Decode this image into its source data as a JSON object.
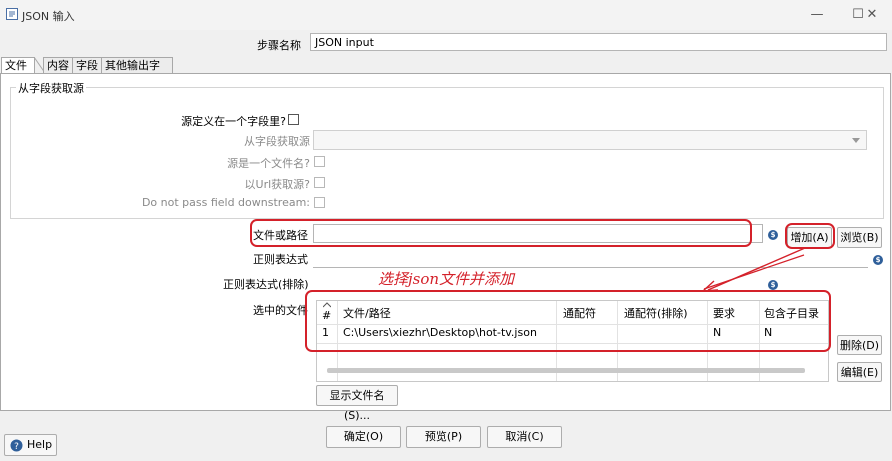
{
  "window": {
    "title": "JSON 输入",
    "minimize": "—",
    "maximize": "☐",
    "close": "✕"
  },
  "step_name": {
    "label": "步骤名称",
    "value": "JSON input"
  },
  "tabs": [
    {
      "label": "文件"
    },
    {
      "label": "内容"
    },
    {
      "label": "字段"
    },
    {
      "label": "其他输出字段"
    }
  ],
  "source_group": {
    "title": "从字段获取源",
    "source_in_field": "源定义在一个字段里?",
    "get_source_from_field": "从字段获取源",
    "source_is_filename": "源是一个文件名?",
    "read_source_as_url": "以Url获取源?",
    "do_not_pass_field": "Do not pass field downstream:"
  },
  "file_or_dir": {
    "label": "文件或路径",
    "value": ""
  },
  "regex": {
    "label": "正则表达式",
    "value": ""
  },
  "regex_exclude": {
    "label": "正则表达式(排除)",
    "value": ""
  },
  "selected_files": {
    "label": "选中的文件"
  },
  "buttons": {
    "add": "增加(A)",
    "browse": "浏览(B)",
    "delete": "删除(D)",
    "edit": "编辑(E)",
    "show_filenames": "显示文件名(S)...",
    "ok": "确定(O)",
    "preview": "预览(P)",
    "cancel": "取消(C)",
    "help": "Help"
  },
  "table": {
    "columns": [
      "#",
      "文件/路径",
      "通配符",
      "通配符(排除)",
      "要求",
      "包含子目录"
    ],
    "rows": [
      [
        "1",
        "C:\\Users\\xiezhr\\Desktop\\hot-tv.json",
        "",
        "",
        "N",
        "N"
      ]
    ]
  },
  "annotation": {
    "text": "选择json文件并添加",
    "color": "#d4212a"
  },
  "icons": {
    "variable": "dollar-variable-icon",
    "help": "help-circle-icon"
  }
}
